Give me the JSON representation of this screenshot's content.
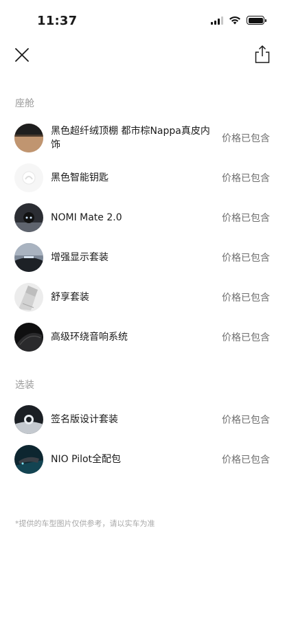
{
  "status": {
    "time": "11:37"
  },
  "sections": [
    {
      "title": "座舱",
      "items": [
        {
          "name": "黑色超纤绒顶棚 都市棕Nappa真皮内饰",
          "price": "价格已包含",
          "thumb": "interior-leather"
        },
        {
          "name": "黑色智能钥匙",
          "price": "价格已包含",
          "thumb": "smart-key"
        },
        {
          "name": "NOMI Mate 2.0",
          "price": "价格已包含",
          "thumb": "nomi"
        },
        {
          "name": "增强显示套装",
          "price": "价格已包含",
          "thumb": "display"
        },
        {
          "name": "舒享套装",
          "price": "价格已包含",
          "thumb": "comfort"
        },
        {
          "name": "高级环绕音响系统",
          "price": "价格已包含",
          "thumb": "audio"
        }
      ]
    },
    {
      "title": "选装",
      "items": [
        {
          "name": "签名版设计套装",
          "price": "价格已包含",
          "thumb": "signature"
        },
        {
          "name": "NIO Pilot全配包",
          "price": "价格已包含",
          "thumb": "pilot"
        }
      ]
    }
  ],
  "disclaimer": "*提供的车型图片仅供参考，请以实车为准",
  "colors": {
    "text": "#1a1a1a",
    "muted": "#9a9a9a",
    "price": "#6e6e6e",
    "background": "#ffffff"
  },
  "icons": {
    "close": "close-icon",
    "share": "share-icon"
  }
}
